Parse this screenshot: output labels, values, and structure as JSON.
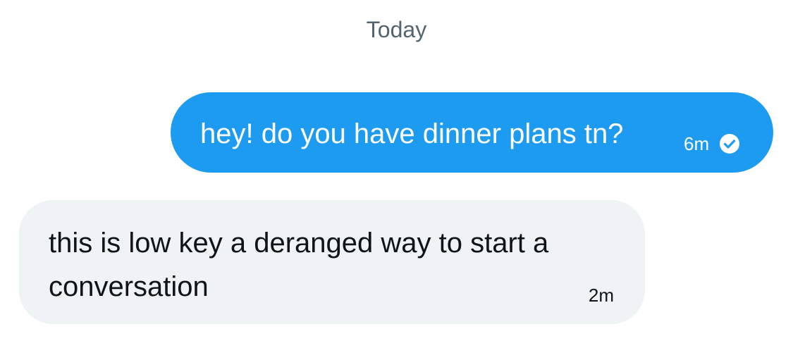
{
  "conversation": {
    "date_separator": "Today",
    "messages": [
      {
        "direction": "sent",
        "text": "hey! do you have dinner plans tn?",
        "time": "6m",
        "status_icon": "check-circle-icon"
      },
      {
        "direction": "received",
        "text": "this is low key a deranged way to start a conversation",
        "time": "2m"
      }
    ]
  },
  "colors": {
    "sent_bubble": "#1d9bf0",
    "received_bubble": "#eff3f4",
    "secondary_text": "#536471",
    "primary_text": "#0f1419"
  }
}
